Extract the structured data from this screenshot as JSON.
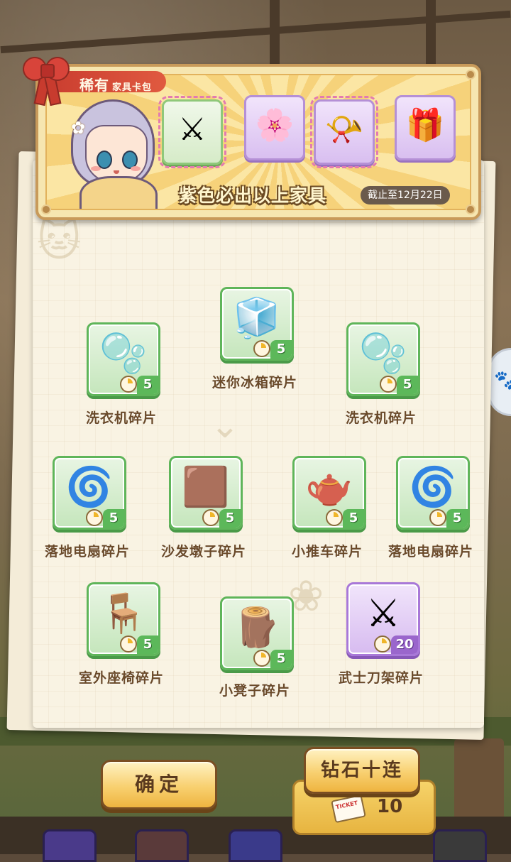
{
  "banner": {
    "title_main": "稀有",
    "title_sub": "家具卡包",
    "guarantee_text": "紫色必出以上家具",
    "deadline_text": "截止至12月22日",
    "featured": [
      {
        "icon": "katana-rack-icon",
        "glyph": "⚔",
        "rarity": "green"
      },
      {
        "icon": "flower-statue-icon",
        "glyph": "🌸",
        "rarity": "purple"
      },
      {
        "icon": "gramophone-icon",
        "glyph": "📯",
        "rarity": "purple"
      },
      {
        "icon": "jack-in-box-icon",
        "glyph": "🎁",
        "rarity": "purple"
      }
    ]
  },
  "rewards": [
    {
      "label": "迷你冰箱碎片",
      "count": "5",
      "icon": "mini-fridge-icon",
      "glyph": "🧊",
      "rarity": "green"
    },
    {
      "label": "洗衣机碎片",
      "count": "5",
      "icon": "washing-machine-icon",
      "glyph": "🫧",
      "rarity": "green"
    },
    {
      "label": "洗衣机碎片",
      "count": "5",
      "icon": "washing-machine-icon",
      "glyph": "🫧",
      "rarity": "green"
    },
    {
      "label": "落地电扇碎片",
      "count": "5",
      "icon": "floor-fan-icon",
      "glyph": "🌀",
      "rarity": "green"
    },
    {
      "label": "沙发墩子碎片",
      "count": "5",
      "icon": "ottoman-icon",
      "glyph": "🟫",
      "rarity": "green"
    },
    {
      "label": "小推车碎片",
      "count": "5",
      "icon": "trolley-icon",
      "glyph": "🫖",
      "rarity": "green"
    },
    {
      "label": "落地电扇碎片",
      "count": "5",
      "icon": "floor-fan-icon",
      "glyph": "🌀",
      "rarity": "green"
    },
    {
      "label": "室外座椅碎片",
      "count": "5",
      "icon": "wicker-chair-icon",
      "glyph": "🪑",
      "rarity": "green"
    },
    {
      "label": "小凳子碎片",
      "count": "5",
      "icon": "stool-icon",
      "glyph": "🪵",
      "rarity": "green"
    },
    {
      "label": "武士刀架碎片",
      "count": "20",
      "icon": "katana-rack-icon",
      "glyph": "⚔",
      "rarity": "purple"
    }
  ],
  "buttons": {
    "confirm": "确定",
    "ten_pull": "钻石十连",
    "ten_pull_cost": "10",
    "ticket_label": "TICKET"
  },
  "colors": {
    "green_card_border": "#5fb55a",
    "purple_card_border": "#a878d8",
    "button_gold": "#f8d070"
  }
}
